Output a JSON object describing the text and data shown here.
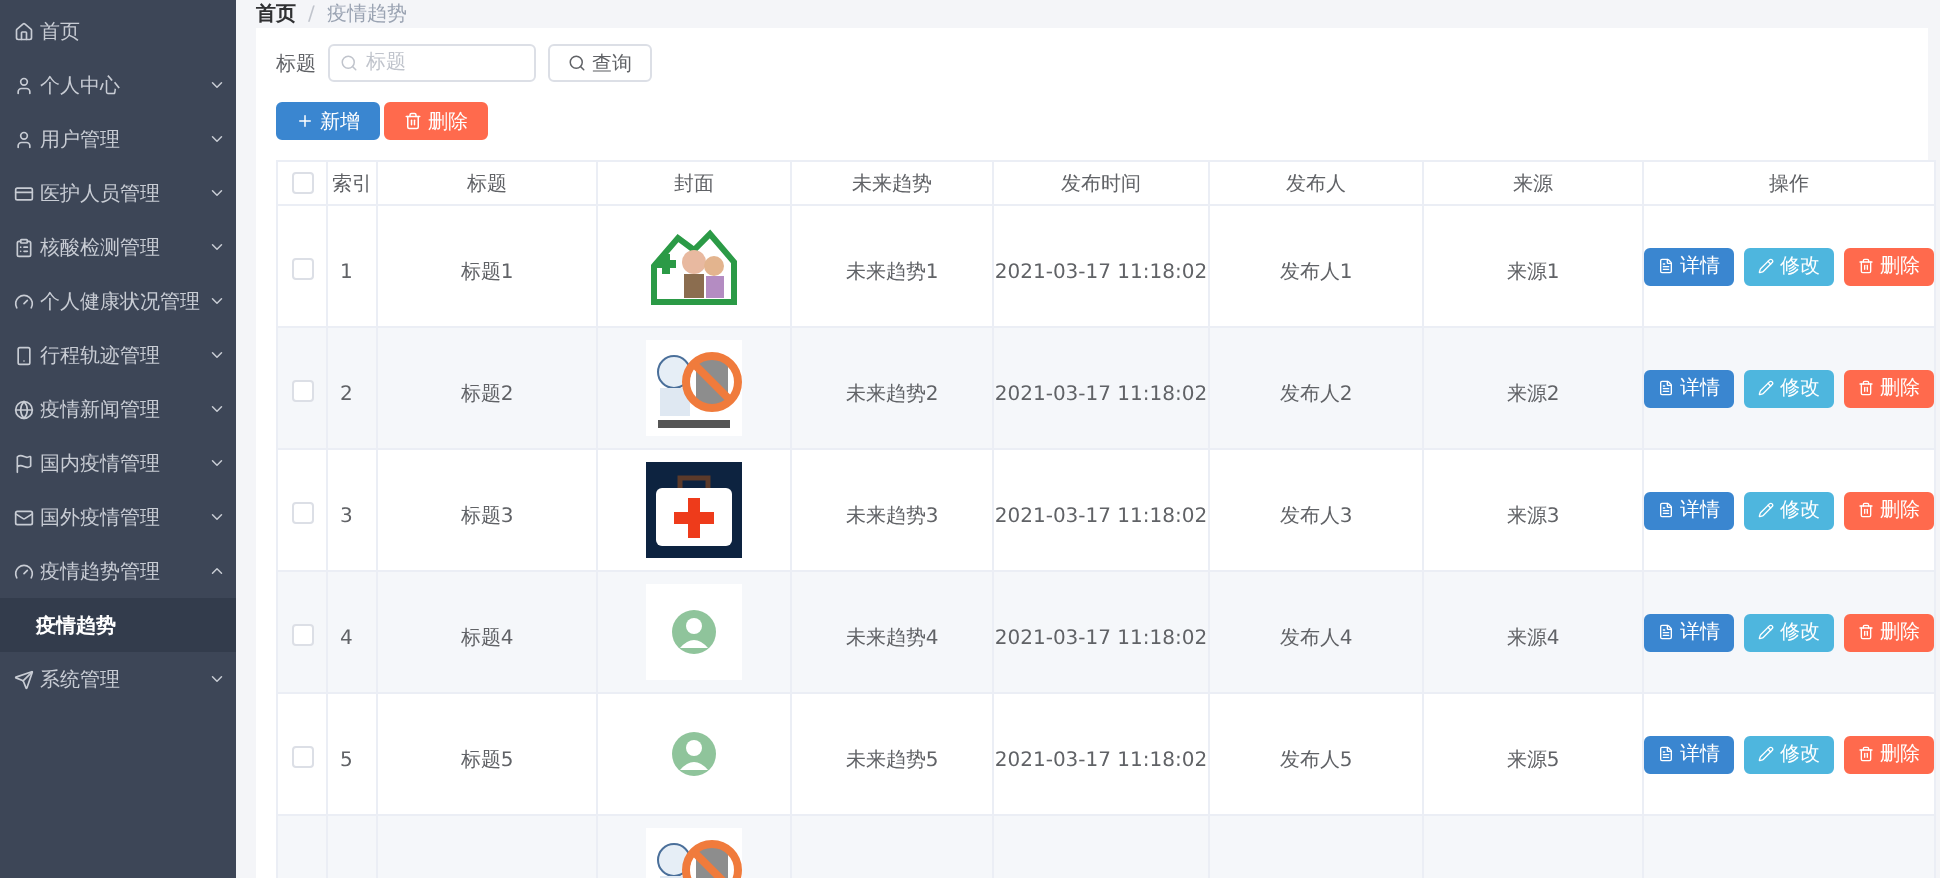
{
  "sidebar": {
    "items": [
      {
        "label": "首页"
      },
      {
        "label": "个人中心",
        "expanded": false
      },
      {
        "label": "用户管理",
        "expanded": false
      },
      {
        "label": "医护人员管理",
        "expanded": false
      },
      {
        "label": "核酸检测管理",
        "expanded": false
      },
      {
        "label": "个人健康状况管理",
        "expanded": false
      },
      {
        "label": "行程轨迹管理",
        "expanded": false
      },
      {
        "label": "疫情新闻管理",
        "expanded": false
      },
      {
        "label": "国内疫情管理",
        "expanded": false
      },
      {
        "label": "国外疫情管理",
        "expanded": false
      },
      {
        "label": "疫情趋势管理",
        "expanded": true,
        "children": [
          {
            "label": "疫情趋势",
            "selected": true
          }
        ]
      },
      {
        "label": "系统管理",
        "expanded": false
      }
    ]
  },
  "breadcrumb": {
    "separator": "/",
    "items": [
      "首页",
      "疫情趋势"
    ]
  },
  "search": {
    "label": "标题",
    "placeholder": "标题",
    "button": "查询"
  },
  "toolbar": {
    "add": "新增",
    "delete": "删除"
  },
  "table": {
    "select_all_checked": false,
    "columns": [
      "索引",
      "标题",
      "封面",
      "未来趋势",
      "发布时间",
      "发布人",
      "来源",
      "操作"
    ],
    "rows": [
      {
        "checked": false,
        "index": "1",
        "title": "标题1",
        "cover": {
          "kind": "picture"
        },
        "trend": "未来趋势1",
        "time": "2021-03-17 11:18:02",
        "publisher": "发布人1",
        "source": "来源1",
        "actions": [
          "详情",
          "修改",
          "删除"
        ]
      },
      {
        "checked": false,
        "index": "2",
        "title": "标题2",
        "cover": {
          "kind": "picture"
        },
        "trend": "未来趋势2",
        "time": "2021-03-17 11:18:02",
        "publisher": "发布人2",
        "source": "来源2",
        "actions": [
          "详情",
          "修改",
          "删除"
        ]
      },
      {
        "checked": false,
        "index": "3",
        "title": "标题3",
        "cover": {
          "kind": "picture"
        },
        "trend": "未来趋势3",
        "time": "2021-03-17 11:18:02",
        "publisher": "发布人3",
        "source": "来源3",
        "actions": [
          "详情",
          "修改",
          "删除"
        ]
      },
      {
        "checked": false,
        "index": "4",
        "title": "标题4",
        "cover": {
          "kind": "picture"
        },
        "trend": "未来趋势4",
        "time": "2021-03-17 11:18:02",
        "publisher": "发布人4",
        "source": "来源4",
        "actions": [
          "详情",
          "修改",
          "删除"
        ]
      },
      {
        "checked": false,
        "index": "5",
        "title": "标题5",
        "cover": {
          "kind": "picture"
        },
        "trend": "未来趋势5",
        "time": "2021-03-17 11:18:02",
        "publisher": "发布人5",
        "source": "来源5",
        "actions": [
          "详情",
          "修改",
          "删除"
        ]
      },
      {
        "cover": {
          "kind": "picture"
        }
      }
    ]
  }
}
